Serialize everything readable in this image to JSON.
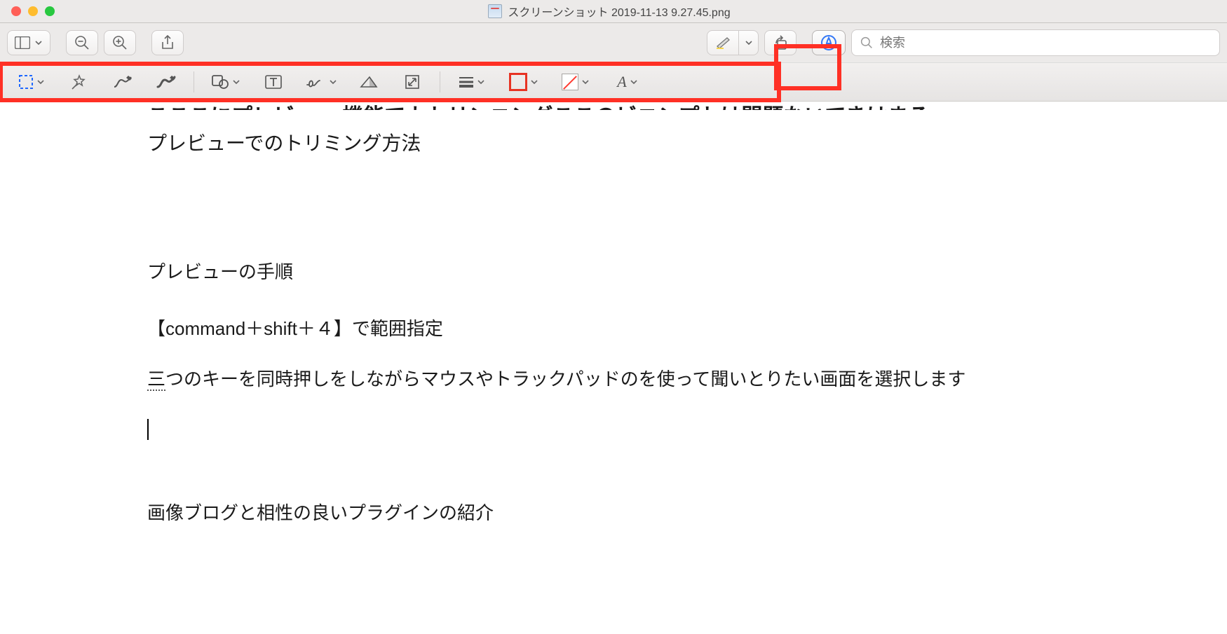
{
  "window": {
    "title": "スクリーンショット 2019-11-13 9.27.45.png"
  },
  "search": {
    "placeholder": "検索"
  },
  "document": {
    "truncated_top": "こここにプレビュー 機能でカトリンニングここのビニンプトは問題ないてきはまる",
    "heading1": "プレビューでのトリミング方法",
    "heading2": "プレビューの手順",
    "shortcut_line_bracket_open": "【",
    "shortcut_line_body": "command＋shift＋４】で範囲指定",
    "instruction_prefix": "三",
    "instruction_rest": "つのキーを同時押しをしながらマウスやトラックパッドのを使って聞いとりたい画面を選択します",
    "heading3": "画像ブログと相性の良いプラグインの紹介"
  }
}
